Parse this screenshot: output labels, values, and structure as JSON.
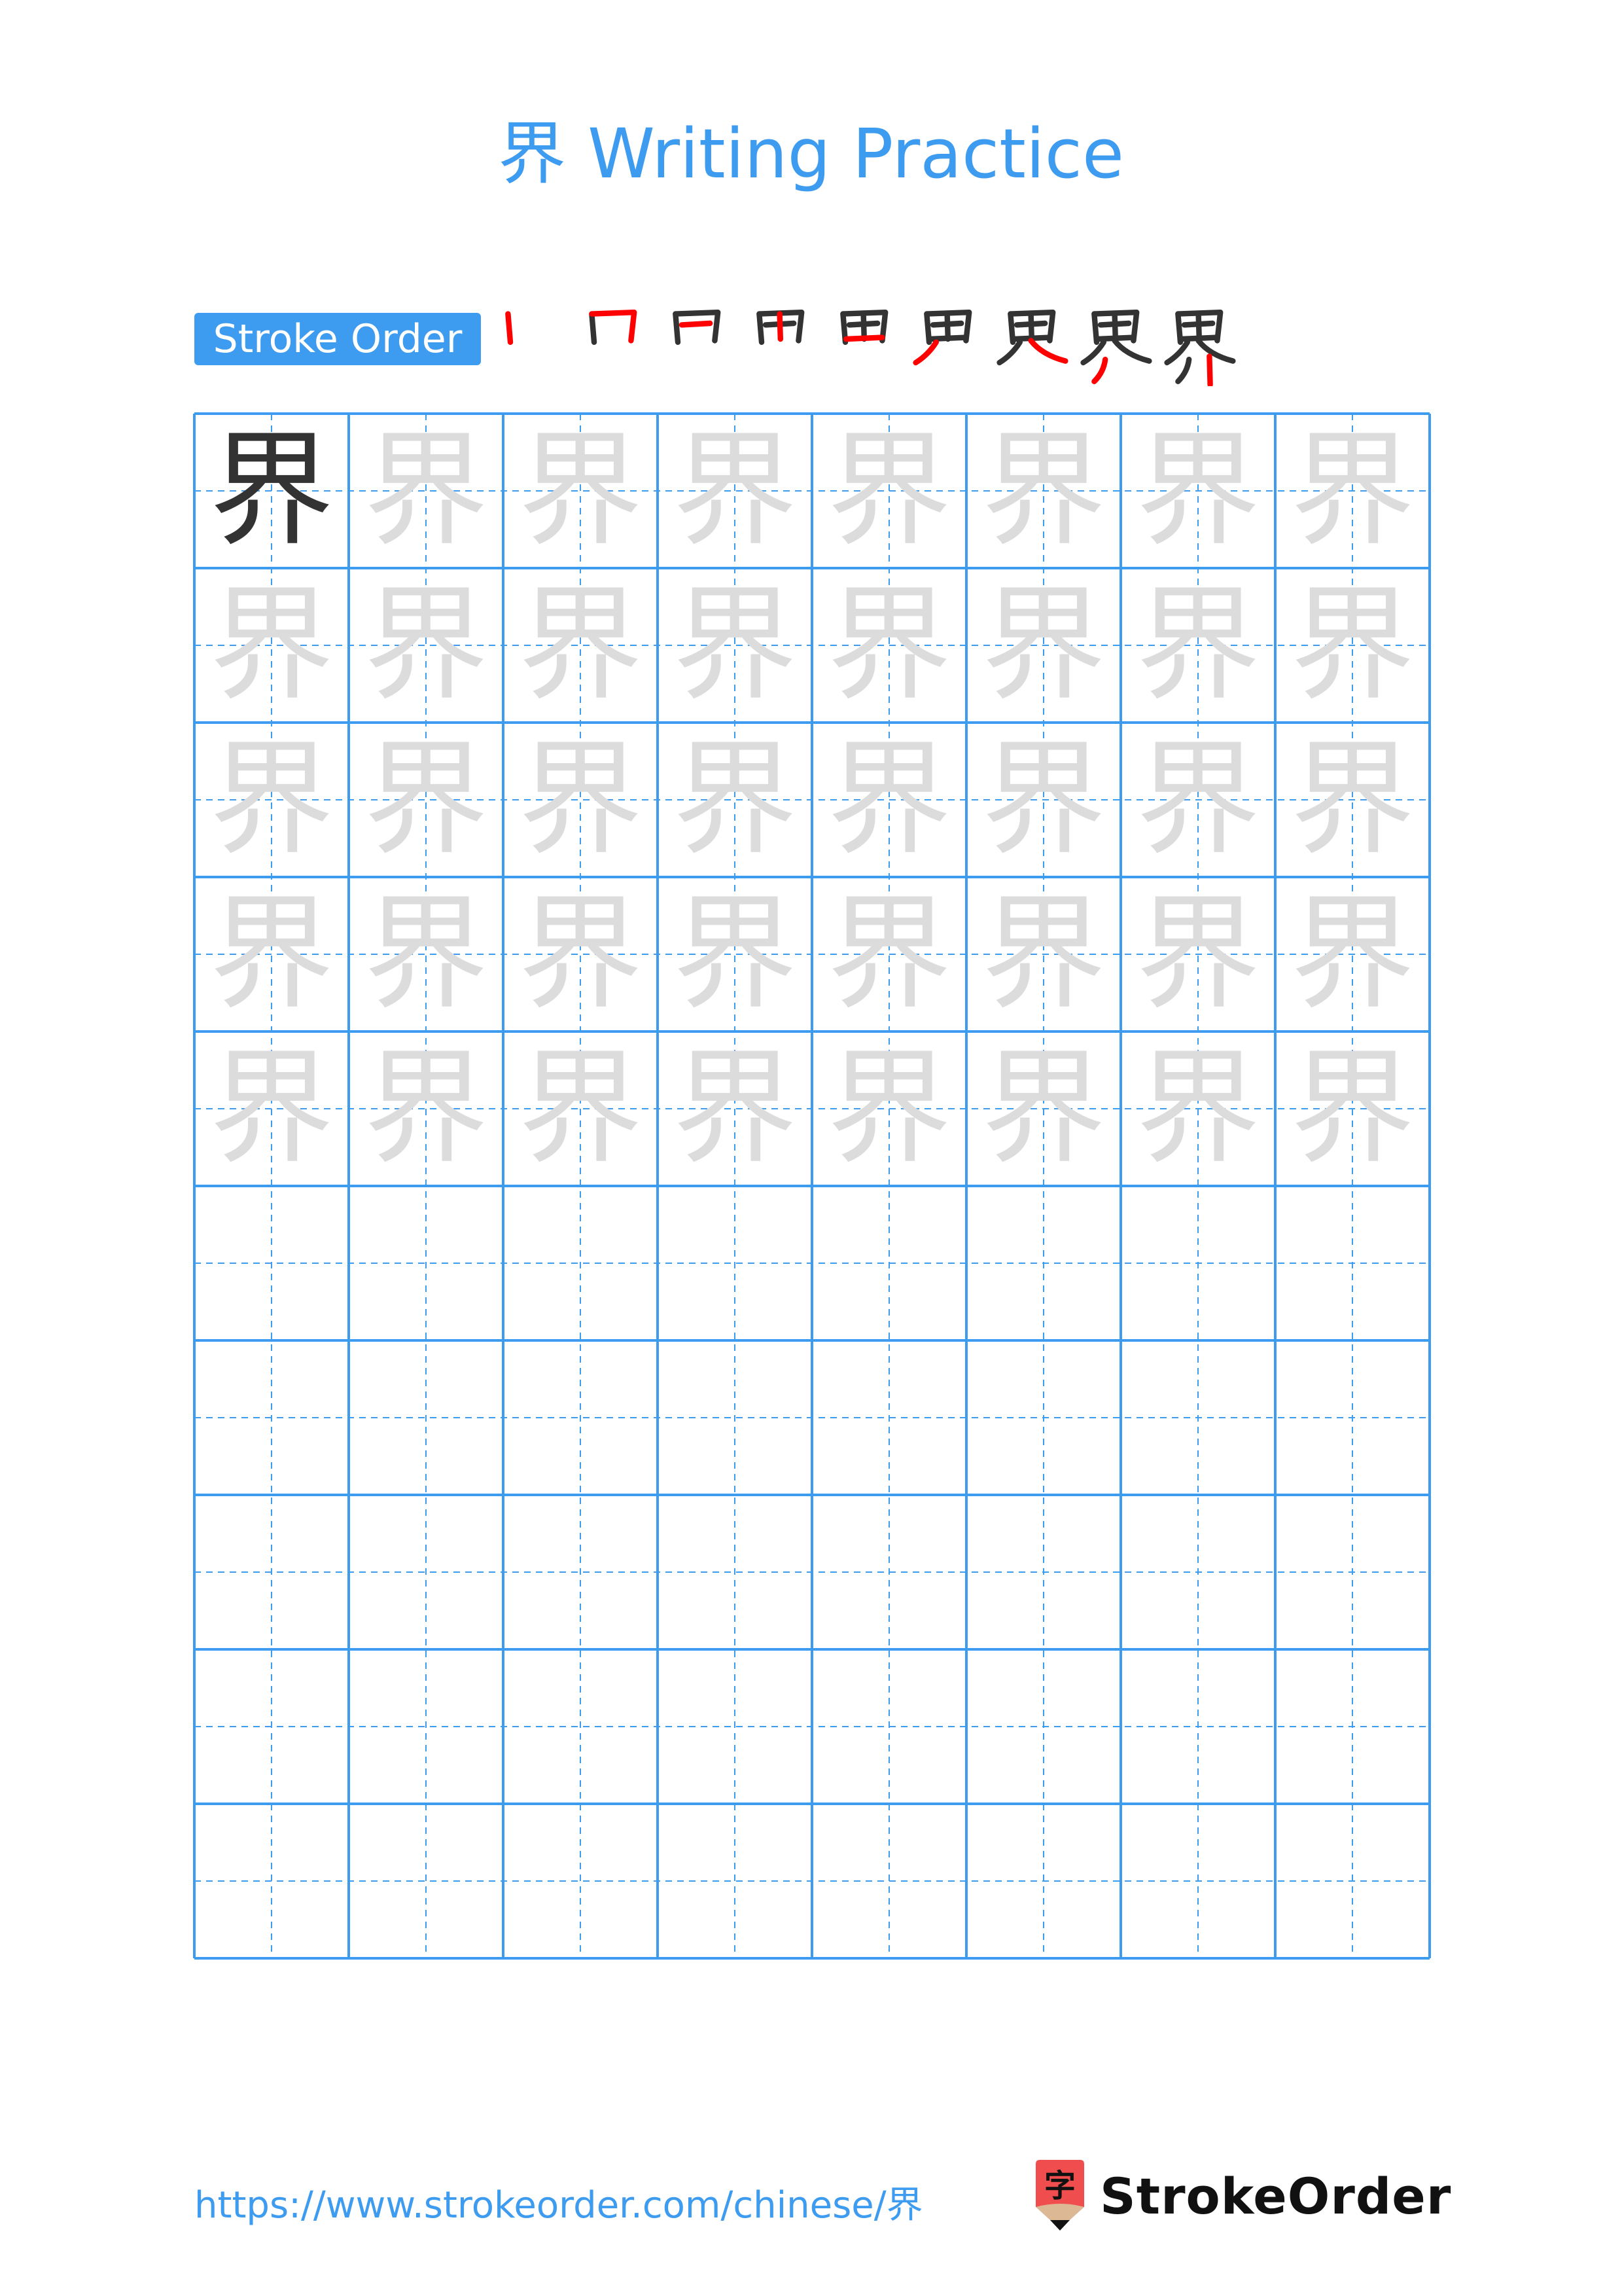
{
  "page": {
    "title": "界 Writing Practice",
    "character": "界"
  },
  "stroke_order": {
    "label": "Stroke Order",
    "stroke_count": 9,
    "highlight_color": "#ff0000",
    "base_color": "#333333"
  },
  "practice_grid": {
    "rows": 10,
    "columns": 8,
    "model_cells": 1,
    "trace_rows": 5,
    "empty_rows": 5,
    "line_color": "#3d9bf0",
    "model_color": "#333333",
    "trace_color": "#dcdcdc"
  },
  "footer": {
    "url": "https://www.strokeorder.com/chinese/界",
    "brand_name": "StrokeOrder",
    "logo_glyph": "字",
    "logo_color": "#f04e4e"
  },
  "colors": {
    "accent": "#3d9bf0"
  }
}
